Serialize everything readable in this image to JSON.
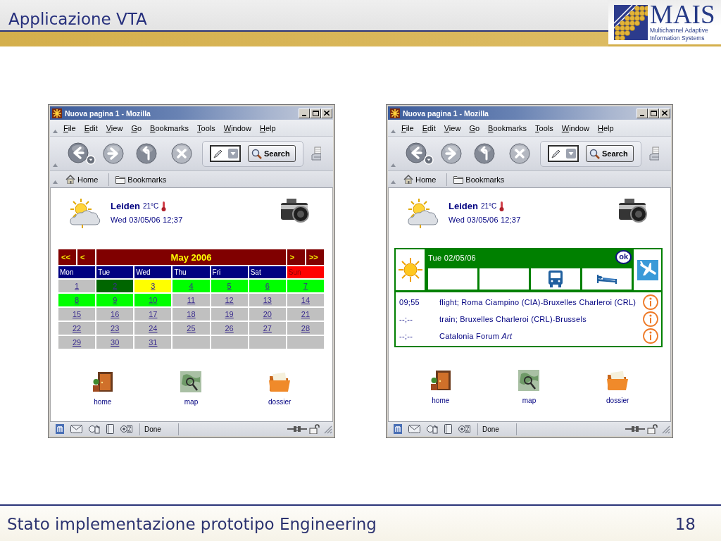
{
  "slide": {
    "title": "Applicazione VTA",
    "logo": {
      "wordmark": "MAIS",
      "tagline": [
        "Multichannel Adaptive",
        "Information Systems"
      ]
    }
  },
  "windows": [
    {
      "kind": "calendar",
      "title": "Nuova pagina 1 - Mozilla",
      "menu": [
        "File",
        "Edit",
        "View",
        "Go",
        "Bookmarks",
        "Tools",
        "Window",
        "Help"
      ],
      "search_button": "Search",
      "personal_toolbar": [
        "Home",
        "Bookmarks"
      ],
      "status": "Done",
      "page": {
        "city": "Leiden",
        "temperature": "21°C",
        "datetime": "Wed 03/05/06 12;37",
        "calendar": {
          "prev": [
            "<<",
            "<"
          ],
          "month": "May 2006",
          "next": [
            ">",
            ">>"
          ],
          "weekdays": [
            {
              "label": "Mon",
              "color": "#000080"
            },
            {
              "label": "Tue",
              "color": "#000080"
            },
            {
              "label": "Wed",
              "color": "#000080"
            },
            {
              "label": "Thu",
              "color": "#000080"
            },
            {
              "label": "Fri",
              "color": "#000080"
            },
            {
              "label": "Sat",
              "color": "#000080"
            },
            {
              "label": "Sun",
              "color": "#ff0000"
            }
          ],
          "days": [
            {
              "label": "1",
              "color": "#c0c0c0"
            },
            {
              "label": "2",
              "color": "#006600"
            },
            {
              "label": "3",
              "color": "#ffff00"
            },
            {
              "label": "4",
              "color": "#00ff00"
            },
            {
              "label": "5",
              "color": "#00ff00"
            },
            {
              "label": "6",
              "color": "#00ff00"
            },
            {
              "label": "7",
              "color": "#00ff00"
            },
            {
              "label": "8",
              "color": "#00ff00"
            },
            {
              "label": "9",
              "color": "#00ff00"
            },
            {
              "label": "10",
              "color": "#00ff00"
            },
            {
              "label": "11",
              "color": "#c0c0c0"
            },
            {
              "label": "12",
              "color": "#c0c0c0"
            },
            {
              "label": "13",
              "color": "#c0c0c0"
            },
            {
              "label": "14",
              "color": "#c0c0c0"
            },
            {
              "label": "15",
              "color": "#c0c0c0"
            },
            {
              "label": "16",
              "color": "#c0c0c0"
            },
            {
              "label": "17",
              "color": "#c0c0c0"
            },
            {
              "label": "18",
              "color": "#c0c0c0"
            },
            {
              "label": "19",
              "color": "#c0c0c0"
            },
            {
              "label": "20",
              "color": "#c0c0c0"
            },
            {
              "label": "21",
              "color": "#c0c0c0"
            },
            {
              "label": "22",
              "color": "#c0c0c0"
            },
            {
              "label": "23",
              "color": "#c0c0c0"
            },
            {
              "label": "24",
              "color": "#c0c0c0"
            },
            {
              "label": "25",
              "color": "#c0c0c0"
            },
            {
              "label": "26",
              "color": "#c0c0c0"
            },
            {
              "label": "27",
              "color": "#c0c0c0"
            },
            {
              "label": "28",
              "color": "#c0c0c0"
            },
            {
              "label": "29",
              "color": "#c0c0c0"
            },
            {
              "label": "30",
              "color": "#c0c0c0"
            },
            {
              "label": "31",
              "color": "#c0c0c0"
            }
          ]
        },
        "shortcuts": [
          "home",
          "map",
          "dossier"
        ]
      }
    },
    {
      "kind": "agenda",
      "title": "Nuova pagina 1 - Mozilla",
      "menu": [
        "File",
        "Edit",
        "View",
        "Go",
        "Bookmarks",
        "Tools",
        "Window",
        "Help"
      ],
      "search_button": "Search",
      "personal_toolbar": [
        "Home",
        "Bookmarks"
      ],
      "status": "Done",
      "page": {
        "city": "Leiden",
        "temperature": "21°C",
        "datetime": "Wed 03/05/06 12;37",
        "agenda": {
          "date": "Tue 02/05/06",
          "badge": "ok",
          "slots": [
            {
              "kind": "empty"
            },
            {
              "kind": "empty"
            },
            {
              "kind": "transport"
            },
            {
              "kind": "lodging"
            }
          ],
          "events": [
            {
              "time": "09;55",
              "text": "flight; Roma Ciampino (CIA)-Bruxelles Charleroi (CRL)"
            },
            {
              "time": "--;--",
              "text": "train; Bruxelles Charleroi (CRL)-Brussels"
            },
            {
              "time": "--;--",
              "text": "Catalonia Forum *Art*"
            }
          ]
        },
        "shortcuts": [
          "home",
          "map",
          "dossier"
        ]
      }
    }
  ],
  "footer": {
    "text": "Stato implementazione prototipo Engineering",
    "page": "18"
  }
}
